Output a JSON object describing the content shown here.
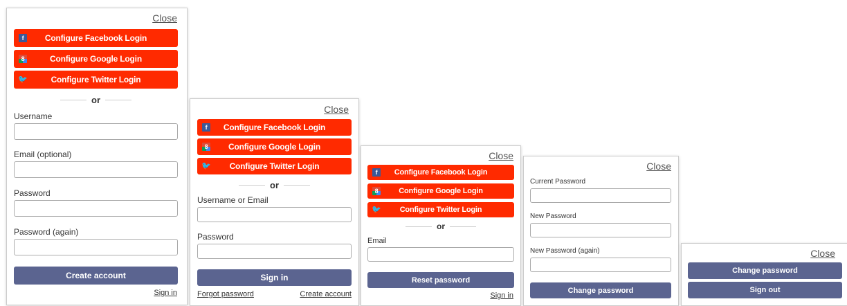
{
  "colors": {
    "social_button": "#ff2a00",
    "primary_button": "#5b6490",
    "facebook": "#3b5998",
    "twitter": "#55acee"
  },
  "icons": {
    "facebook": "facebook-icon",
    "google": "google-icon",
    "twitter": "twitter-icon"
  },
  "common": {
    "close": "Close",
    "facebook_login": "Configure Facebook Login",
    "google_login": "Configure Google Login",
    "twitter_login": "Configure Twitter Login",
    "or": "or",
    "facebook_glyph": "f",
    "google_glyph": "8",
    "twitter_glyph": "🐦"
  },
  "create_account_panel": {
    "username_label": "Username",
    "email_label": "Email (optional)",
    "password_label": "Password",
    "password_again_label": "Password (again)",
    "username_value": "",
    "email_value": "",
    "password_value": "",
    "password_again_value": "",
    "submit": "Create account",
    "sign_in_link": "Sign in"
  },
  "sign_in_panel": {
    "username_or_email_label": "Username or Email",
    "password_label": "Password",
    "username_value": "",
    "password_value": "",
    "submit": "Sign in",
    "forgot_link": "Forgot password",
    "create_link": "Create account"
  },
  "reset_panel": {
    "email_label": "Email",
    "email_value": "",
    "submit": "Reset password",
    "sign_in_link": "Sign in"
  },
  "change_password_panel": {
    "current_label": "Current Password",
    "new_label": "New Password",
    "new_again_label": "New Password (again)",
    "current_value": "",
    "new_value": "",
    "new_again_value": "",
    "submit": "Change password"
  },
  "signed_in_panel": {
    "change_password": "Change password",
    "sign_out": "Sign out"
  }
}
